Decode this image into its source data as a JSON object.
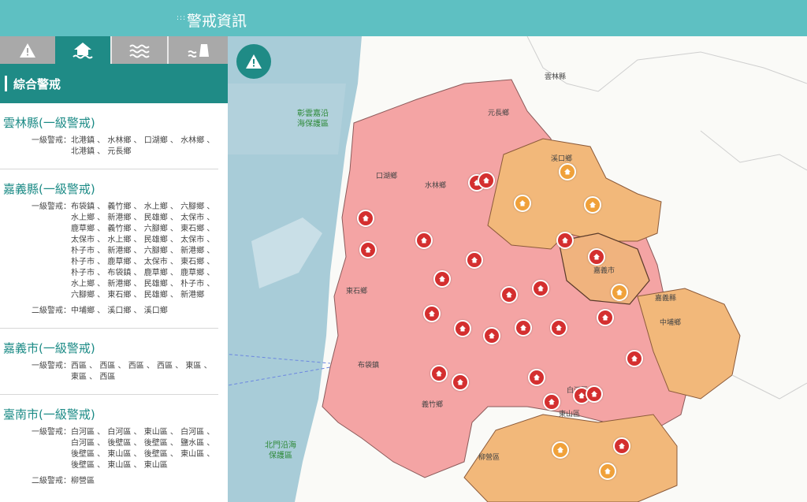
{
  "header": {
    "title": "警戒資訊"
  },
  "tabs": [
    {
      "icon": "warning-triangle-icon"
    },
    {
      "icon": "flood-house-icon"
    },
    {
      "icon": "waves-icon"
    },
    {
      "icon": "dam-icon"
    }
  ],
  "section": {
    "title": "綜合警戒"
  },
  "counties": [
    {
      "title": "雲林縣(一級警戒)",
      "rows": [
        {
          "label": "一級警戒：",
          "towns": "北港鎮 、 水林鄉 、 口湖鄉 、 水林鄉 、 北港鎮 、 元長鄉"
        }
      ]
    },
    {
      "title": "嘉義縣(一級警戒)",
      "rows": [
        {
          "label": "一級警戒：",
          "towns": "布袋鎮 、 義竹鄉 、 水上鄉 、 六腳鄉 、 水上鄉 、 新港鄉 、 民雄鄉 、 太保市 、 鹿草鄉 、 義竹鄉 、 六腳鄉 、 東石鄉 、 太保市 、 水上鄉 、 民雄鄉 、 太保市 、 朴子市 、 新港鄉 、 六腳鄉 、 新港鄉 、 朴子市 、 鹿草鄉 、 太保市 、 東石鄉 、 朴子市 、 布袋鎮 、 鹿草鄉 、 鹿草鄉 、 水上鄉 、 新港鄉 、 民雄鄉 、 朴子市 、 六腳鄉 、 東石鄉 、 民雄鄉 、 新港鄉"
        },
        {
          "label": "二級警戒：",
          "towns": "中埔鄉 、 溪口鄉 、 溪口鄉"
        }
      ]
    },
    {
      "title": "嘉義市(一級警戒)",
      "rows": [
        {
          "label": "一級警戒：",
          "towns": "西區 、 西區 、 西區 、 西區 、 東區 、 東區 、 西區"
        }
      ]
    },
    {
      "title": "臺南市(一級警戒)",
      "rows": [
        {
          "label": "一級警戒：",
          "towns": "白河區 、 白河區 、 東山區 、 白河區 、 白河區 、 後壁區 、 後壁區 、 鹽水區 、 後壁區 、 東山區 、 後壁區 、 東山區 、 後壁區 、 東山區 、 東山區"
        },
        {
          "label": "二級警戒：",
          "towns": "柳營區"
        }
      ]
    }
  ],
  "map_labels": {
    "yunlin": "雲林縣",
    "chiayi_city": "嘉義市",
    "chiayi_county": "嘉義縣",
    "sea1": "彰雲嘉沿\n海保護區",
    "sea2": "北門沿海\n保護區",
    "yuanchang": "元長鄉",
    "kouhu": "口湖鄉",
    "shuilin": "水林鄉",
    "xikou": "溪口鄉",
    "dongshi": "東石鄉",
    "budai": "布袋鎮",
    "zhongpu": "中埔鄉",
    "yizhu": "義竹鄉",
    "dongshan": "東山區",
    "liuying": "柳營區",
    "baihe": "白河區"
  },
  "colors": {
    "header": "#5ec0c2",
    "accent": "#1f8b86",
    "level1_fill": "#f4a4a4",
    "level2_fill": "#f2b87a",
    "sea": "#a8ccd8",
    "pin_red": "#d42f2f",
    "pin_orange": "#f0a13a"
  }
}
